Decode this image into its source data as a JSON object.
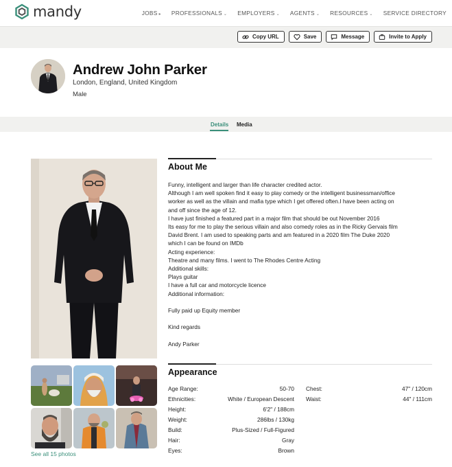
{
  "brand": {
    "name": "mandy",
    "accent": "#3a8f7a"
  },
  "nav": {
    "items": [
      {
        "label": "JOBS",
        "caret": "▸"
      },
      {
        "label": "PROFESSIONALS",
        "caret": "⌄"
      },
      {
        "label": "EMPLOYERS",
        "caret": "⌄"
      },
      {
        "label": "AGENTS",
        "caret": "⌄"
      },
      {
        "label": "RESOURCES",
        "caret": "⌄"
      },
      {
        "label": "SERVICE DIRECTORY",
        "caret": ""
      }
    ]
  },
  "actions": {
    "copy_url": "Copy URL",
    "save": "Save",
    "message": "Message",
    "invite": "Invite to Apply"
  },
  "profile": {
    "name": "Andrew John Parker",
    "location": "London, England, United Kingdom",
    "gender": "Male"
  },
  "tabs": {
    "details": "Details",
    "media": "Media",
    "active": "Details"
  },
  "photos": {
    "see_all": "See all 15 photos"
  },
  "about": {
    "title": "About Me",
    "lines": [
      "Funny, intelligent and larger than life character credited actor.",
      "Although I am well spoken find it easy to play comedy or the intelligent businessman/office",
      "worker as well as the villain and mafia type which I get offered often.I have been acting on",
      "and off since the age of 12.",
      "I have just finished a featured part in a major film that should be out November 2016",
      "Its easy for me to play the serious villain and also comedy roles as in the Ricky Gervais film",
      "David Brent. I am used to speaking parts and am featured in a 2020 film The Duke 2020",
      "which I can be found on IMDb",
      "Acting experience:",
      "Theatre and many films. I went to The Rhodes Centre Acting",
      "Additional skills:",
      "Plays guitar",
      "I have a full car and motorcycle licence",
      "Additional information:",
      "",
      "Fully paid up Equity member",
      "",
      "Kind regards",
      "",
      "Andy Parker"
    ]
  },
  "appearance": {
    "title": "Appearance",
    "left": [
      {
        "label": "Age Range:",
        "value": "50-70"
      },
      {
        "label": "Ethnicities:",
        "value": "White / European Descent"
      },
      {
        "label": "Height:",
        "value": "6'2\" / 188cm"
      },
      {
        "label": "Weight:",
        "value": "286lbs / 130kg"
      },
      {
        "label": "Build:",
        "value": "Plus-Sized / Full-Figured"
      },
      {
        "label": "Hair:",
        "value": "Gray"
      },
      {
        "label": "Eyes:",
        "value": "Brown"
      }
    ],
    "right": [
      {
        "label": "Chest:",
        "value": "47\" / 120cm"
      },
      {
        "label": "Waist:",
        "value": "44\" / 111cm"
      }
    ]
  }
}
